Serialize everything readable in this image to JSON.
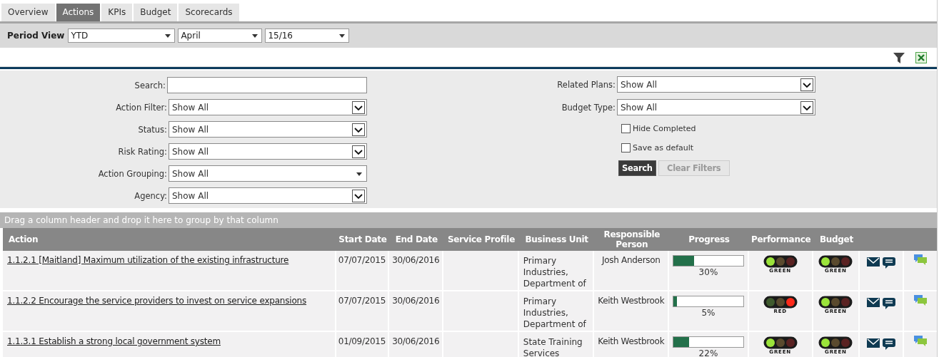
{
  "tabs": [
    {
      "label": "Overview",
      "selected": false
    },
    {
      "label": "Actions",
      "selected": true
    },
    {
      "label": "KPIs",
      "selected": false
    },
    {
      "label": "Budget",
      "selected": false
    },
    {
      "label": "Scorecards",
      "selected": false
    }
  ],
  "period_view": {
    "label": "Period View",
    "selects": [
      "YTD",
      "April",
      "15/16"
    ]
  },
  "filters_left": [
    {
      "label": "Search:",
      "kind": "text"
    },
    {
      "label": "Action Filter:",
      "kind": "select",
      "value": "Show All"
    },
    {
      "label": "Status:",
      "kind": "select",
      "value": "Show All"
    },
    {
      "label": "Risk Rating:",
      "kind": "select",
      "value": "Show All"
    },
    {
      "label": "Action Grouping:",
      "kind": "combo",
      "value": "Show All"
    },
    {
      "label": "Agency:",
      "kind": "select",
      "value": "Show All"
    }
  ],
  "filters_right": [
    {
      "label": "Related Plans:",
      "value": "Show All"
    },
    {
      "label": "Budget Type:",
      "value": "Show All"
    }
  ],
  "checkboxes": [
    {
      "label": "Hide Completed",
      "checked": false
    },
    {
      "label": "Save as default",
      "checked": false
    }
  ],
  "buttons": [
    {
      "label": "Search",
      "disabled": false
    },
    {
      "label": "Clear Filters",
      "disabled": true
    }
  ],
  "group_panel": "Drag a column header and drop it here to group by that column",
  "table": {
    "columns": [
      "Action",
      "Start Date",
      "End Date",
      "Service Profile",
      "Business Unit",
      "Responsible Person",
      "Progress",
      "Performance",
      "Budget"
    ],
    "rows": [
      {
        "action": "1.1.2.1 [Maitland] Maximum utilization of the existing infrastructure",
        "start": "07/07/2015",
        "end": "30/06/2016",
        "business_unit": "Primary Industries, Department of",
        "person": "Josh Anderson",
        "level": 0.3,
        "progress": "30%",
        "performance": {
          "kind": "green",
          "label": "GREEN"
        },
        "budget": {
          "kind": "green",
          "label": "GREEN"
        }
      },
      {
        "action": "1.1.2.2 Encourage the service providers to invest on service expansions",
        "start": "07/07/2015",
        "end": "30/06/2016",
        "business_unit": "Primary Industries, Department of",
        "person": "Keith Westbrook",
        "level": 0.05,
        "progress": "5%",
        "performance": {
          "kind": "red",
          "label": "RED"
        },
        "budget": {
          "kind": "green",
          "label": "GREEN"
        }
      },
      {
        "action": "1.1.3.1 Establish a strong local government system",
        "start": "01/09/2015",
        "end": "30/06/2016",
        "business_unit": "State Training Services",
        "person": "Keith Westbrook",
        "level": 0.22,
        "progress": "22%",
        "performance": {
          "kind": "green",
          "label": "GREEN"
        },
        "budget": {
          "kind": "green",
          "label": "GREEN"
        }
      }
    ]
  }
}
